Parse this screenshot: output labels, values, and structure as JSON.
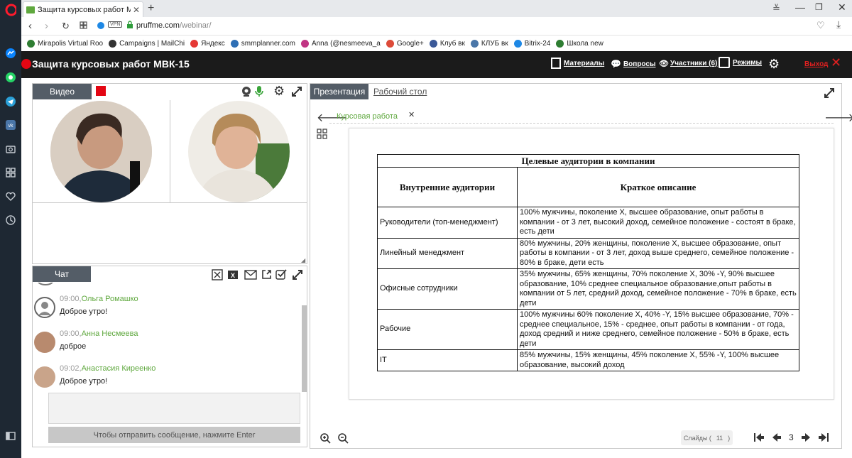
{
  "browser": {
    "tab_title": "Защита курсовых работ М",
    "url_domain": "pruffme.com",
    "url_path": "/webinar/",
    "vpn_label": "VPN",
    "bookmarks": [
      {
        "label": "Mirapolis Virtual Roo",
        "color": "#2e7d32"
      },
      {
        "label": "Campaigns | MailChi",
        "color": "#333"
      },
      {
        "label": "Яндекс",
        "color": "#e53935"
      },
      {
        "label": "smmplanner.com",
        "color": "#2e6fb5"
      },
      {
        "label": "Anna (@nesmeeva_a",
        "color": "#c13584"
      },
      {
        "label": "Google+",
        "color": "#dd4b39"
      },
      {
        "label": "Клуб вк",
        "color": "#3b5998"
      },
      {
        "label": "КЛУБ вк",
        "color": "#4a76a8"
      },
      {
        "label": "Bitrix-24",
        "color": "#1e88e5"
      },
      {
        "label": "Школа new",
        "color": "#2e7d32"
      }
    ]
  },
  "app": {
    "title": "Защита курсовых работ МВК-15",
    "nav": {
      "materials": "Материалы",
      "questions": "Вопросы",
      "participants": "Участники (6)",
      "modes": "Режимы",
      "exit": "Выход"
    }
  },
  "video": {
    "tab_label": "Видео"
  },
  "chat": {
    "tab_label": "Чат",
    "messages": [
      {
        "time": "09:00,",
        "author": "Ольга Ромашко",
        "text": "Доброе утро!"
      },
      {
        "time": "09:00,",
        "author": "Анна Несмеева",
        "text": "доброе"
      },
      {
        "time": "09:02,",
        "author": "Анастасия Киреенко",
        "text": "Доброе утро!"
      }
    ],
    "send_hint": "Чтобы отправить сообщение, нажмите Enter"
  },
  "presentation": {
    "tabs": {
      "active": "Презентация",
      "other": "Рабочий стол"
    },
    "doc_tab": "Курсовая работа",
    "slides_label": "Слайды (",
    "slides_count": "11",
    "slides_close": ")",
    "current_slide": "3",
    "table": {
      "title": "Целевые аудитории в компании",
      "headers": [
        "Внутренние аудитории",
        "Краткое описание"
      ],
      "rows": [
        {
          "audience": "Руководители (топ-менеджмент)",
          "desc": "100% мужчины, поколение Х, высшее образование, опыт работы в компании - от 3 лет, высокий доход, семейное положение - состоят в браке, есть дети"
        },
        {
          "audience": "Линейный менеджмент",
          "desc": "80% мужчины, 20% женщины, поколение Х, высшее образование, опыт работы в компании - от 3 лет, доход выше среднего, семейное положение - 80% в браке, дети есть"
        },
        {
          "audience": "Офисные сотрудники",
          "desc": "35% мужчины, 65% женщины, 70% поколение Х, 30% -Y, 90% высшее образование, 10% среднее специальное образование,опыт работы в компании от 5 лет, средний доход, семейное положение - 70% в браке, есть дети"
        },
        {
          "audience": "Рабочие",
          "desc": "100% мужчины 60% поколение Х, 40% -Y, 15% высшее образование, 70% - среднее специальное, 15% - среднее, опыт работы в компании -  от  года, доход средний и ниже среднего, семейное положение - 50% в браке, есть дети"
        },
        {
          "audience": "IT",
          "desc": "85% мужчины, 15% женщины, 45% поколение Х, 55% -Y, 100% высшее образование, высокий доход"
        }
      ]
    }
  },
  "colors": {
    "accent_green": "#5fa83e",
    "record_red": "#e30613",
    "exit_red": "#e02020",
    "panel_head": "#545d67"
  }
}
